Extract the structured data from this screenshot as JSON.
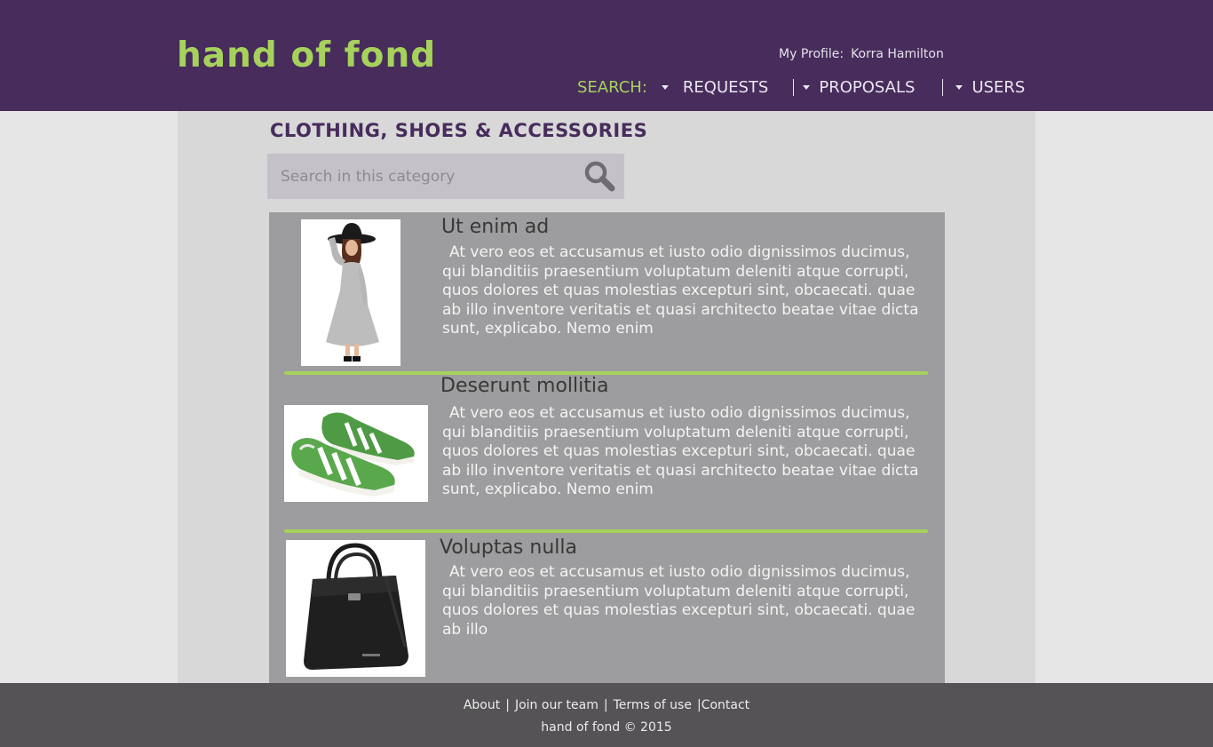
{
  "header": {
    "logo": "hand of fond",
    "profile_label": "My Profile:",
    "profile_name": "Korra Hamilton",
    "nav": {
      "search_label": "SEARCH:",
      "requests_label": "REQUESTS",
      "proposals_label": "PROPOSALS",
      "users_label": "USERS"
    }
  },
  "main": {
    "page_title": "CLOTHING, SHOES & ACCESSORIES",
    "search": {
      "placeholder": "Search in this category"
    },
    "listings": [
      {
        "title": "Ut enim ad",
        "description": "At vero eos et accusamus et iusto odio dignissimos ducimus, qui blanditiis praesentium voluptatum deleniti atque corrupti, quos dolores et quas molestias excepturi sint, obcaecati. quae ab illo inventore veritatis et quasi architecto beatae vitae dicta sunt, explicabo. Nemo enim",
        "image": "dress-photo"
      },
      {
        "title": "Deserunt mollitia",
        "description": "At vero eos et accusamus et iusto odio dignissimos ducimus, qui blanditiis praesentium voluptatum deleniti atque corrupti, quos dolores et quas molestias excepturi sint, obcaecati. quae ab illo inventore veritatis et quasi architecto beatae vitae dicta sunt, explicabo. Nemo enim",
        "image": "sneakers-photo"
      },
      {
        "title": "Voluptas nulla",
        "description": "At vero eos et accusamus et iusto odio dignissimos ducimus, qui blanditiis praesentium voluptatum deleniti atque corrupti, quos dolores et quas molestias excepturi sint, obcaecati. quae ab illo",
        "image": "handbag-photo"
      }
    ]
  },
  "footer": {
    "links": [
      "About",
      "Join our team",
      "Terms of use",
      "Contact"
    ],
    "copyright": "hand of fond © 2015"
  },
  "colors": {
    "header_bg": "#472c5c",
    "accent_green": "#a6d25c",
    "panel_bg": "#9d9c9e",
    "footer_bg": "#555355"
  },
  "icons": [
    "search-icon",
    "caret-down-icon"
  ]
}
